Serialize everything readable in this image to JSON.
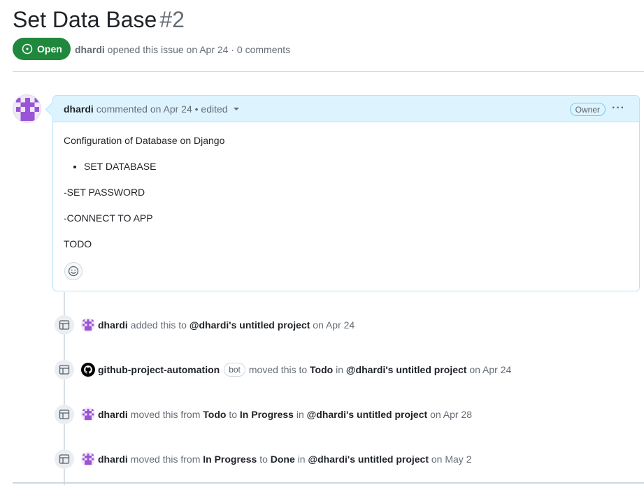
{
  "issue": {
    "title": "Set Data Base",
    "number": "#2",
    "state": "Open",
    "author": "dhardi",
    "meta_text": "opened this issue on Apr 24 · 0 comments"
  },
  "comment": {
    "author": "dhardi",
    "header_text": "commented on Apr 24 • edited",
    "role_badge": "Owner",
    "more_icon": "kebab-horizontal-icon",
    "body": {
      "intro": "Configuration of Database on Django",
      "bullet": "SET DATABASE",
      "line1": "-SET PASSWORD",
      "line2": "-CONNECT TO APP",
      "line3": "TODO"
    },
    "reaction_icon": "smiley-icon"
  },
  "timeline": [
    {
      "actor": "dhardi",
      "parts": [
        "added this to",
        "@dhardi's untitled project",
        "on Apr 24"
      ]
    },
    {
      "actor": "github-project-automation",
      "bot_badge": "bot",
      "parts": [
        "moved this to",
        "Todo",
        "in",
        "@dhardi's untitled project",
        "on Apr 24"
      ]
    },
    {
      "actor": "dhardi",
      "parts": [
        "moved this from",
        "Todo",
        "to",
        "In Progress",
        "in",
        "@dhardi's untitled project",
        "on Apr 28"
      ]
    },
    {
      "actor": "dhardi",
      "parts": [
        "moved this from",
        "In Progress",
        "to",
        "Done",
        "in",
        "@dhardi's untitled project",
        "on May 2"
      ]
    }
  ],
  "colors": {
    "open_green": "#1f883d",
    "header_blue": "#ddf4ff",
    "avatar_purple": "#9a55d6"
  }
}
